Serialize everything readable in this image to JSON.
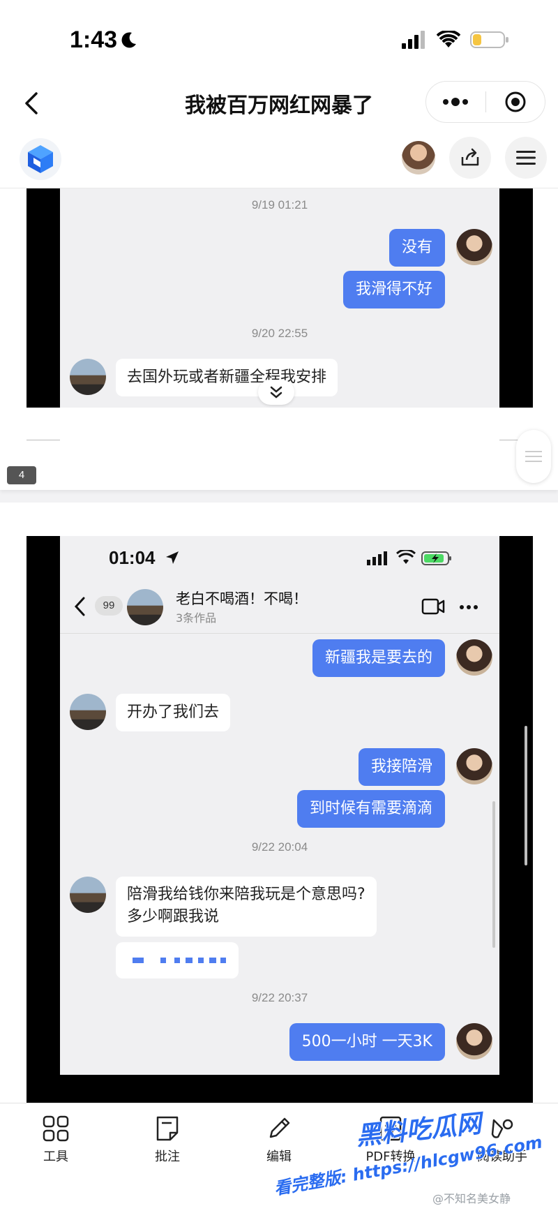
{
  "status_bar": {
    "time": "1:43"
  },
  "nav": {
    "title": "我被百万网红网暴了"
  },
  "page1": {
    "timestamp1": "9/19 01:21",
    "msg_r1": "没有",
    "msg_r2": "我滑得不好",
    "timestamp2": "9/20 22:55",
    "msg_l1": "去国外玩或者新疆全程我安排",
    "page_number": "4"
  },
  "page2": {
    "inner_time": "01:04",
    "unread_badge": "99",
    "contact_name": "老白不喝酒！不喝！",
    "contact_sub": "3条作品",
    "msg_r1": "新疆我是要去的",
    "msg_l1": "开办了我们去",
    "msg_r2": "我接陪滑",
    "msg_r3": "到时候有需要滴滴",
    "timestamp1": "9/22 20:04",
    "msg_l2_line1": "陪滑我给钱你来陪我玩是个意思吗?",
    "msg_l2_line2": "多少啊跟我说",
    "timestamp2": "9/22 20:37",
    "msg_r4": "500一小时 一天3K"
  },
  "bottom_bar": {
    "items": [
      {
        "label": "工具",
        "icon": "grid-icon"
      },
      {
        "label": "批注",
        "icon": "note-icon"
      },
      {
        "label": "编辑",
        "icon": "pencil-icon"
      },
      {
        "label": "PDF转换",
        "icon": "pdf-convert-icon"
      },
      {
        "label": "阅读助手",
        "icon": "reading-assistant-icon"
      }
    ]
  },
  "watermark": {
    "brand": "黑料吃瓜网",
    "url_line": "看完整版: https://hlcgw96.com",
    "weibo": "@不知名美女静"
  },
  "colors": {
    "bubble_blue": "#4f7df0",
    "chat_bg": "#f0f0f2",
    "watermark_blue": "#2a6cf0"
  }
}
